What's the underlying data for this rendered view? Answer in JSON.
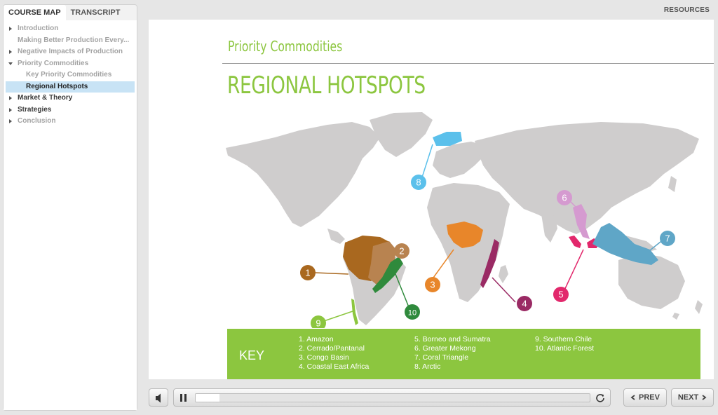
{
  "sidebar": {
    "tabs": [
      {
        "label": "COURSE MAP"
      },
      {
        "label": "TRANSCRIPT"
      }
    ],
    "items": [
      {
        "label": "Introduction"
      },
      {
        "label": "Making Better Production Every..."
      },
      {
        "label": "Negative Impacts of Production"
      },
      {
        "label": "Priority Commodities"
      },
      {
        "label": "Key Priority Commodities"
      },
      {
        "label": "Regional Hotspots"
      },
      {
        "label": "Market & Theory"
      },
      {
        "label": "Strategies"
      },
      {
        "label": "Conclusion"
      }
    ]
  },
  "header": {
    "resources_label": "RESOURCES"
  },
  "slide": {
    "section_title": "Priority Commodities",
    "title": "REGIONAL HOTSPOTS",
    "map": {
      "markers": [
        "1",
        "2",
        "3",
        "4",
        "5",
        "6",
        "7",
        "8",
        "9",
        "10"
      ],
      "colors": {
        "land": "#cfcdcd",
        "amazon": "#a9681f",
        "cerrado": "#b88350",
        "congo": "#e8862a",
        "east_africa": "#9a2a64",
        "borneo": "#e2286c",
        "mekong": "#d59ad0",
        "coral": "#5fa6c7",
        "arctic": "#5bc0eb",
        "chile": "#8cc63f",
        "atlantic": "#2f8a3c"
      }
    },
    "key": {
      "label": "KEY",
      "col1": [
        "1. Amazon",
        "2. Cerrado/Pantanal",
        "3. Congo Basin",
        "4. Coastal East Africa"
      ],
      "col2": [
        "5. Borneo and Sumatra",
        "6. Greater Mekong",
        "7. Coral Triangle",
        "8. Arctic"
      ],
      "col3": [
        "9. Southern Chile",
        "10. Atlantic Forest"
      ]
    }
  },
  "player": {
    "progress": 0.06,
    "prev_label": "PREV",
    "next_label": "NEXT"
  }
}
